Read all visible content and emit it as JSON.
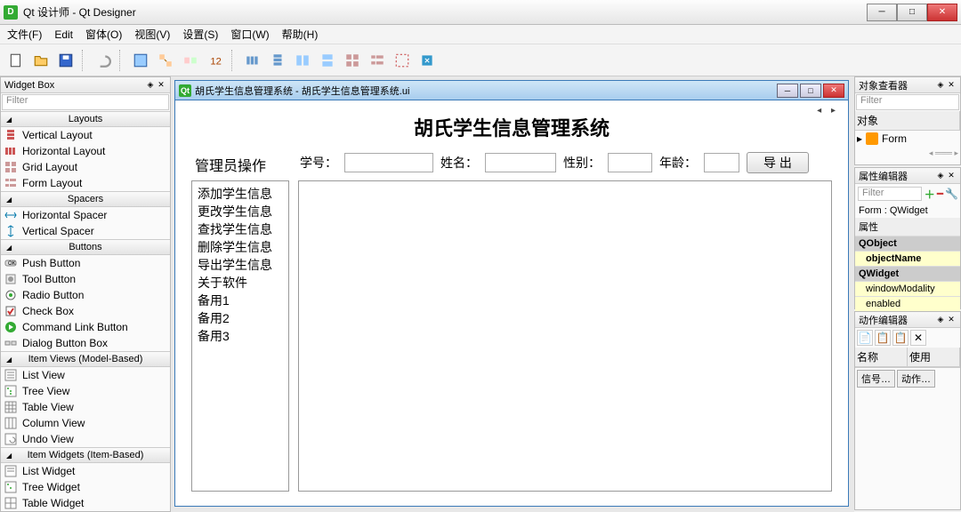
{
  "window": {
    "title": "Qt 设计师 - Qt Designer"
  },
  "menu": {
    "file": "文件(F)",
    "edit": "Edit",
    "form": "窗体(O)",
    "view": "视图(V)",
    "settings": "设置(S)",
    "window": "窗口(W)",
    "help": "帮助(H)"
  },
  "widgetbox": {
    "title": "Widget Box",
    "filter": "Filter",
    "cat_layouts": "Layouts",
    "layouts": [
      "Vertical Layout",
      "Horizontal Layout",
      "Grid Layout",
      "Form Layout"
    ],
    "cat_spacers": "Spacers",
    "spacers": [
      "Horizontal Spacer",
      "Vertical Spacer"
    ],
    "cat_buttons": "Buttons",
    "buttons": [
      "Push Button",
      "Tool Button",
      "Radio Button",
      "Check Box",
      "Command Link Button",
      "Dialog Button Box"
    ],
    "cat_itemviews": "Item Views (Model-Based)",
    "itemviews": [
      "List View",
      "Tree View",
      "Table View",
      "Column View",
      "Undo View"
    ],
    "cat_itemwidgets": "Item Widgets (Item-Based)",
    "itemwidgets": [
      "List Widget",
      "Tree Widget",
      "Table Widget"
    ]
  },
  "mdi": {
    "title": "胡氏学生信息管理系统 - 胡氏学生信息管理系统.ui"
  },
  "form": {
    "title": "胡氏学生信息管理系统",
    "admin": "管理员操作",
    "menu": [
      "添加学生信息",
      "更改学生信息",
      "查找学生信息",
      "删除学生信息",
      "导出学生信息",
      "关于软件",
      "备用1",
      "备用2",
      "备用3"
    ],
    "l_id": "学号：",
    "l_name": "姓名：",
    "l_sex": "性别：",
    "l_age": "年龄：",
    "export": "导 出"
  },
  "objinspector": {
    "title": "对象查看器",
    "filter": "Filter",
    "col1": "对象",
    "row1": "Form"
  },
  "propeditor": {
    "title": "属性编辑器",
    "filter": "Filter",
    "formlabel": "Form : QWidget",
    "col1": "属性",
    "r1": "QObject",
    "r2": "objectName",
    "r3": "QWidget",
    "r4": "windowModality",
    "r5": "enabled"
  },
  "actioneditor": {
    "title": "动作编辑器",
    "col1": "名称",
    "col2": "使用"
  },
  "bottom": {
    "signal": "信号…",
    "action": "动作…"
  }
}
